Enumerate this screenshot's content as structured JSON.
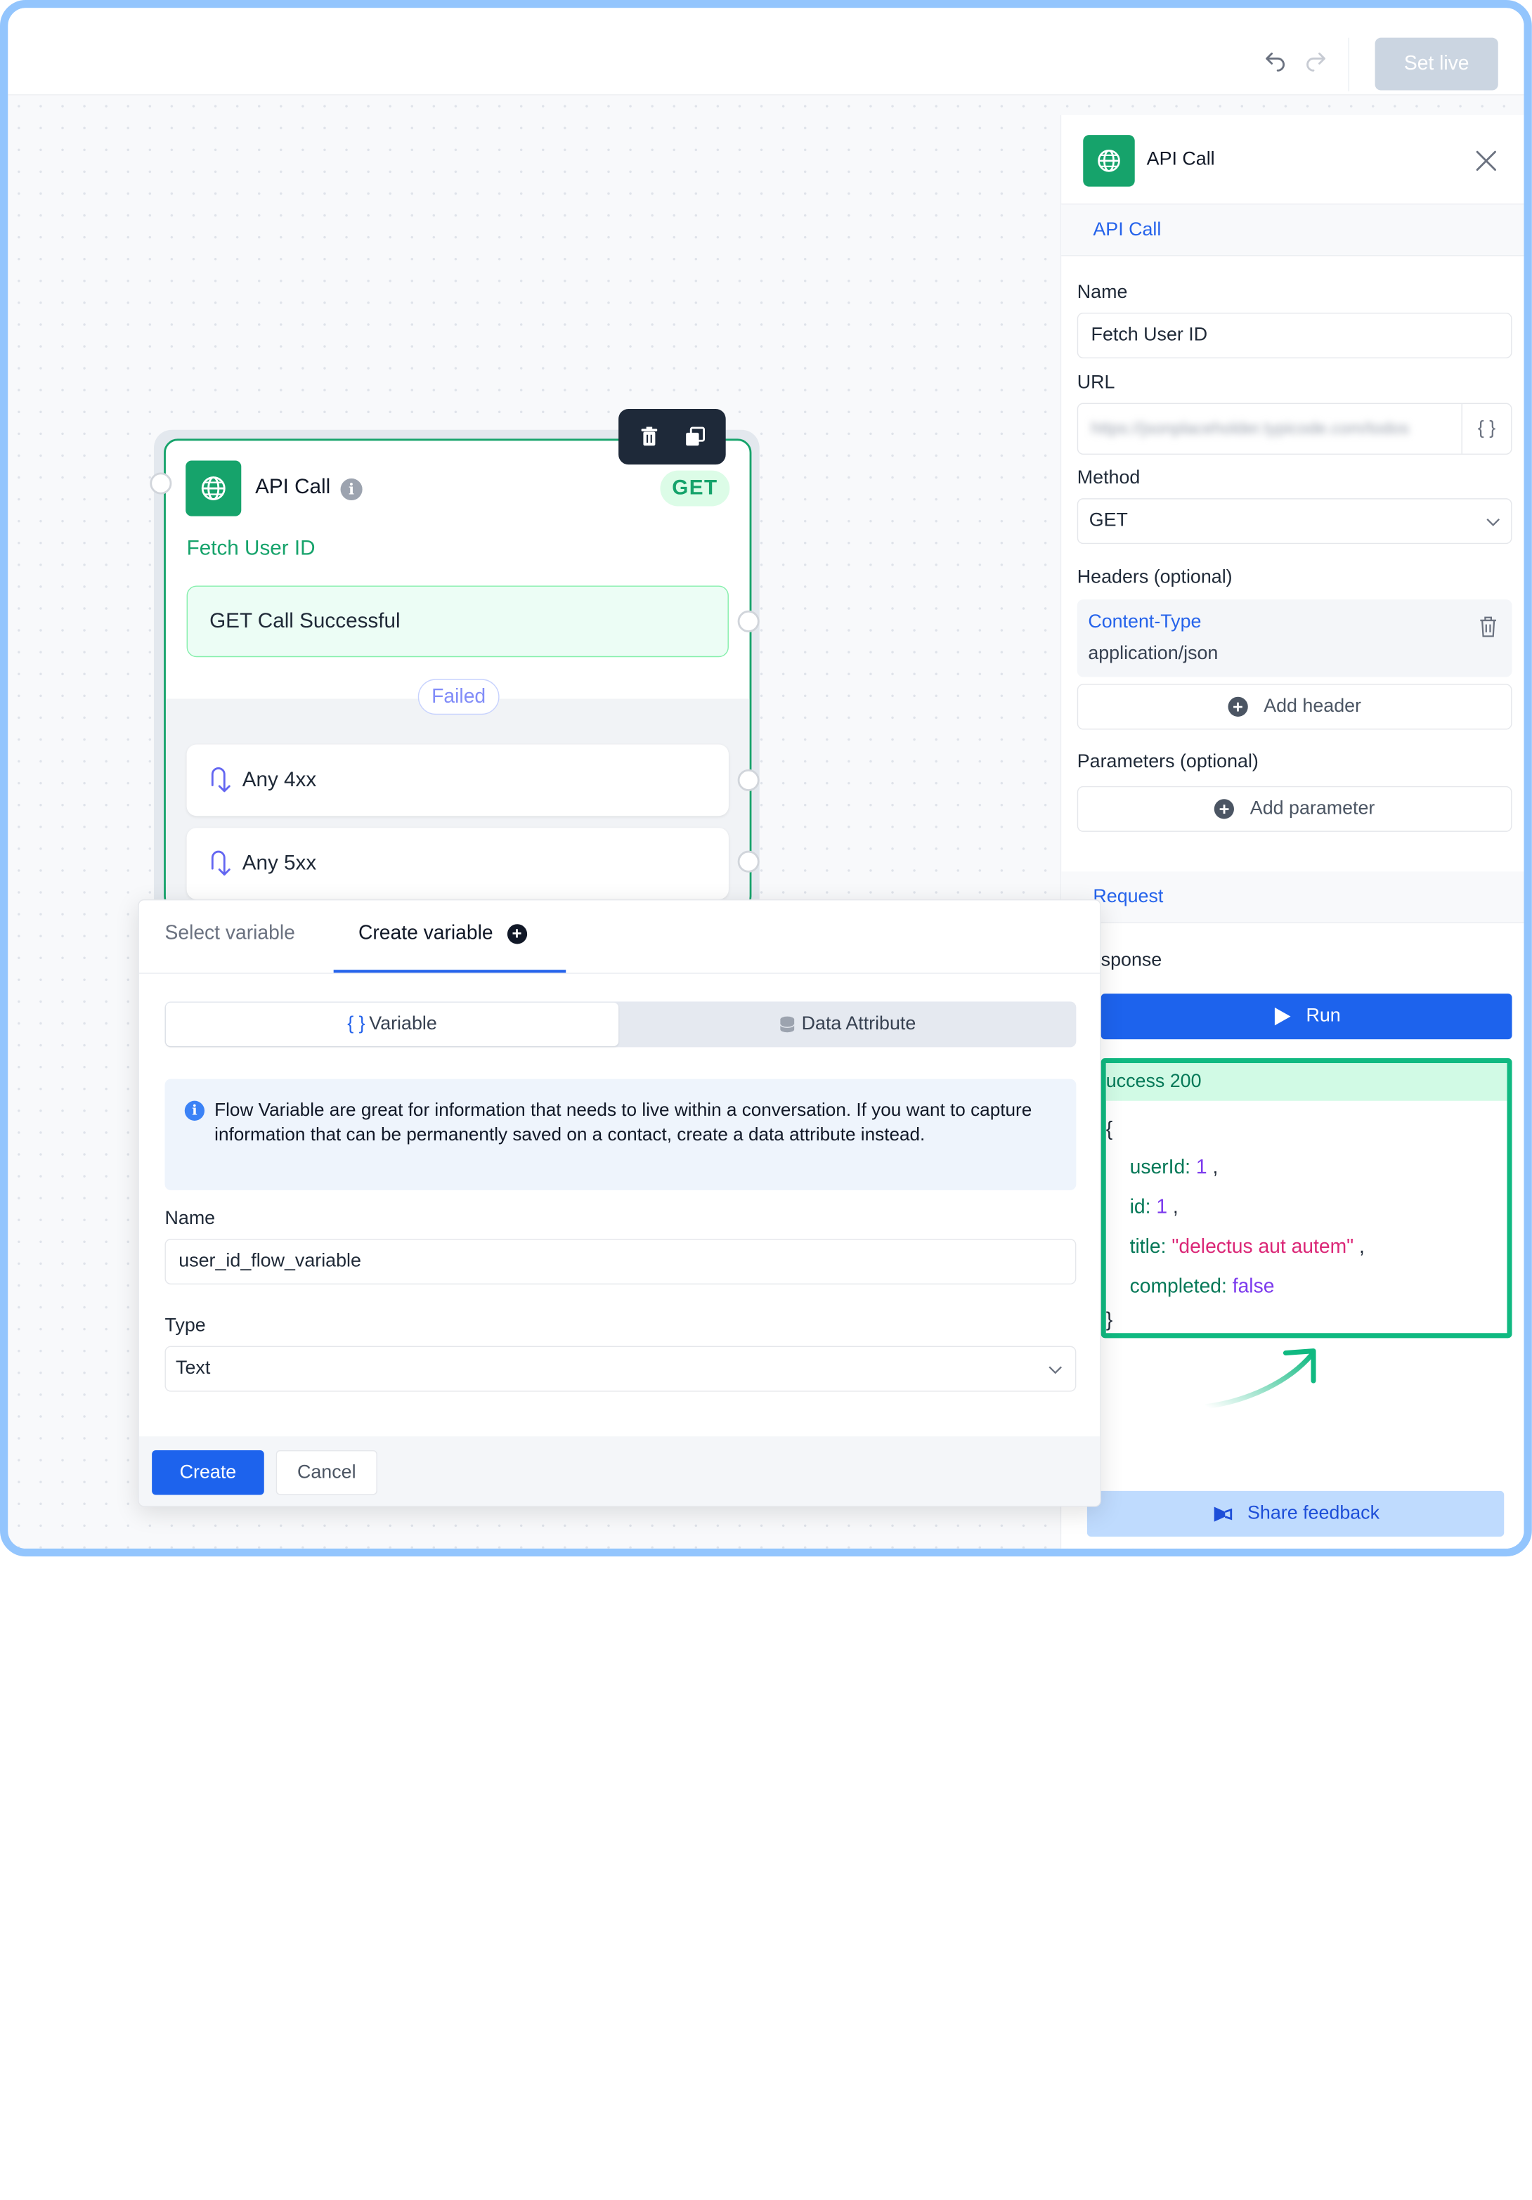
{
  "toolbar": {
    "set_live_label": "Set live"
  },
  "node": {
    "title": "API Call",
    "method_badge": "GET",
    "name": "Fetch User ID",
    "success_label": "GET Call Successful",
    "failed_label": "Failed",
    "error_paths": [
      "Any 4xx",
      "Any 5xx"
    ]
  },
  "panel": {
    "title": "API Call",
    "section_api": "API Call",
    "name_label": "Name",
    "name_value": "Fetch User ID",
    "url_label": "URL",
    "url_value": "https://jsonplaceholder.typicode.com/todos",
    "method_label": "Method",
    "method_value": "GET",
    "headers_label": "Headers (optional)",
    "header_key": "Content-Type",
    "header_value": "application/json",
    "add_header_label": "Add header",
    "params_label": "Parameters (optional)",
    "add_param_label": "Add parameter",
    "section_request": "Request",
    "response_label": "sponse",
    "run_label": "Run",
    "response_status": "uccess 200",
    "response_body": {
      "open": "{",
      "close": "}",
      "k1": "userId:",
      "v1": "1",
      "k2": "id:",
      "v2": "1",
      "k3": "title:",
      "v3": "\"delectus aut autem\"",
      "k4": "completed:",
      "v4": "false",
      "comma": ","
    },
    "feedback_label": "Share feedback"
  },
  "modal": {
    "tab_select": "Select variable",
    "tab_create": "Create variable",
    "seg_variable": "Variable",
    "seg_variable_icon": "{ }",
    "seg_attribute": "Data Attribute",
    "info_text": "Flow Variable are great for information that needs to live within a conversation. If you want to capture information that can be permanently saved on a contact, create a data attribute instead.",
    "name_label": "Name",
    "name_value": "user_id_flow_variable",
    "type_label": "Type",
    "type_value": "Text",
    "create_label": "Create",
    "cancel_label": "Cancel"
  },
  "colors": {
    "accent_green": "#16a36b",
    "primary_blue": "#1d63ed",
    "highlight_border": "#10b981",
    "frame_border": "#93c5fd"
  },
  "icons": [
    "undo-icon",
    "redo-icon",
    "globe-icon",
    "info-icon",
    "trash-icon",
    "duplicate-icon",
    "close-icon",
    "braces-icon",
    "chevron-down-icon",
    "plus-circle-icon",
    "play-icon",
    "database-icon",
    "megaphone-icon",
    "arrow-curve-icon"
  ]
}
